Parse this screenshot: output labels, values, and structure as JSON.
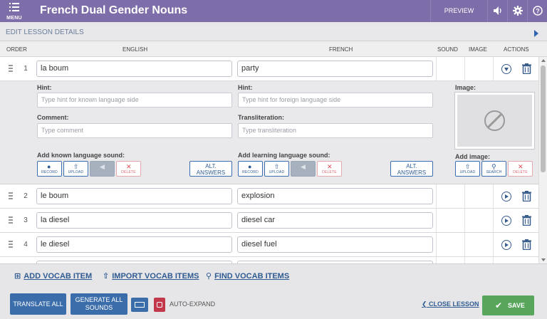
{
  "topbar": {
    "menu_label": "MENU",
    "title": "French Dual Gender Nouns",
    "preview_label": "PREVIEW",
    "icons": [
      "menu-icon",
      "speaker-icon",
      "gear-icon",
      "help-icon"
    ],
    "color": "#7d6da8"
  },
  "details": {
    "label": "EDIT LESSON DETAILS"
  },
  "table": {
    "headers": {
      "order": "ORDER",
      "english": "ENGLISH",
      "french": "FRENCH",
      "sound": "SOUND",
      "image": "IMAGE",
      "actions": "ACTIONS"
    },
    "rows": [
      {
        "order": "1",
        "english": "la boum",
        "french": "party"
      },
      {
        "order": "2",
        "english": "le boum",
        "french": "explosion"
      },
      {
        "order": "3",
        "english": "la diesel",
        "french": "diesel car"
      },
      {
        "order": "4",
        "english": "le diesel",
        "french": "diesel fuel"
      },
      {
        "order": "",
        "english": "",
        "french": ""
      }
    ],
    "expanded": {
      "hint_label": "Hint:",
      "known_hint_placeholder": "Type hint for known language side",
      "foreign_hint_placeholder": "Type hint for foreign language side",
      "comment_label": "Comment:",
      "comment_placeholder": "Type comment",
      "transliteration_label": "Transliteration:",
      "transliteration_placeholder": "Type transliteration",
      "image_label": "Image:",
      "add_known_sound": "Add known language sound:",
      "add_learning_sound": "Add learning language sound:",
      "add_image": "Add image:",
      "record": "RECORD",
      "upload": "UPLOAD",
      "delete": "DELETE",
      "search": "SEARCH",
      "alt_answers_1": "ALT.",
      "alt_answers_2": "ANSWERS"
    }
  },
  "links": {
    "add_vocab": "ADD VOCAB ITEM",
    "import_vocab": "IMPORT VOCAB ITEMS",
    "find_vocab": "FIND VOCAB ITEMS"
  },
  "footer": {
    "translate_all": "TRANSLATE ALL",
    "generate_1": "GENERATE ALL",
    "generate_2": "SOUNDS",
    "auto_expand": "AUTO-EXPAND",
    "close_lesson": "CLOSE LESSON",
    "save": "SAVE",
    "save_color": "#58a55c",
    "button_color": "#3b6dab"
  }
}
